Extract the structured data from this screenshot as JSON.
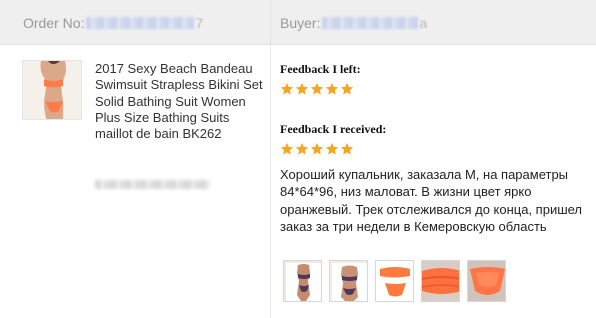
{
  "header": {
    "order_label": "Order No:",
    "order_visible_tail": "7",
    "buyer_label": "Buyer:",
    "buyer_visible_tail": "a"
  },
  "product": {
    "title": "2017 Sexy Beach Bandeau Swimsuit Strapless Bikini Set Solid Bathing Suit Women Plus Size Bathing Suits maillot de bain BK262"
  },
  "feedback_left": {
    "label": "Feedback I left:",
    "stars": 5
  },
  "feedback_received": {
    "label": "Feedback I received:",
    "stars": 5,
    "text": "Хороший купальник, заказала М, на параметры 84*64*96, низ маловат. В жизни цвет ярко оранжевый. Трек отслеживался до конца, пришел заказ за три недели в Кемеровскую область"
  },
  "colors": {
    "star": "#f5a623",
    "header_bg": "#efefef",
    "swimsuit": "#ff7b4a"
  }
}
